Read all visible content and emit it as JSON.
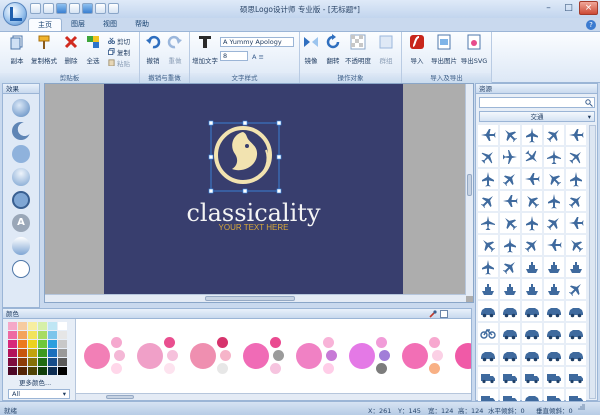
{
  "app": {
    "title": "硕思Logo设计师 专业版 - [无标题*]"
  },
  "tabs": [
    "主页",
    "图层",
    "视图",
    "帮助"
  ],
  "active_tab": "主页",
  "ribbon": {
    "groups": [
      {
        "label": "剪贴板",
        "buttons": [
          "副本",
          "复制格式",
          "删除",
          "全选"
        ],
        "small": [
          "剪切",
          "复制",
          "粘贴"
        ]
      },
      {
        "label": "撤销与重做",
        "buttons": [
          "撤销",
          "重做"
        ]
      },
      {
        "label": "文字样式",
        "buttons": [
          "增加文字"
        ],
        "font_name": "A Yummy Apology",
        "font_size": "8"
      },
      {
        "label": "操作对象",
        "buttons": [
          "镜像",
          "翻转",
          "不透明度",
          "群组"
        ]
      },
      {
        "label": "导入及导出",
        "buttons": [
          "导入",
          "导出图片",
          "导出SVG"
        ]
      }
    ]
  },
  "panels": {
    "effects": "效果",
    "resources": "资源",
    "colors": "颜色"
  },
  "resources": {
    "category": "交通",
    "icon_rows": [
      [
        "plane-icon",
        "plane-icon",
        "plane-icon",
        "plane-icon",
        "plane-icon"
      ],
      [
        "jet-icon",
        "jet-icon",
        "jet-icon",
        "jet-icon",
        "jet-icon"
      ],
      [
        "plane-icon",
        "plane-icon",
        "plane-icon",
        "plane-icon",
        "plane-icon"
      ],
      [
        "plane-icon",
        "plane-icon",
        "plane-icon",
        "plane-icon",
        "plane-icon"
      ],
      [
        "jet-icon",
        "plane-icon",
        "plane-icon",
        "plane-icon",
        "plane-icon"
      ],
      [
        "plane-icon",
        "plane-icon",
        "plane-icon",
        "plane-icon",
        "plane-icon"
      ],
      [
        "plane-icon",
        "plane-icon",
        "ship-icon",
        "ship-icon",
        "ship-icon"
      ],
      [
        "ship-icon",
        "ship-icon",
        "ship-icon",
        "ship-icon",
        "plane-icon"
      ],
      [
        "car-icon",
        "car-icon",
        "car-icon",
        "car-icon",
        "car-icon"
      ],
      [
        "bike-icon",
        "car-icon",
        "car-icon",
        "car-icon",
        "car-icon"
      ],
      [
        "car-icon",
        "car-icon",
        "car-icon",
        "car-icon",
        "car-icon"
      ],
      [
        "truck-icon",
        "truck-icon",
        "truck-icon",
        "truck-icon",
        "truck-icon"
      ],
      [
        "truck-icon",
        "truck-icon",
        "car-icon",
        "truck-icon",
        "truck-icon"
      ]
    ]
  },
  "colors": {
    "palette": [
      "#f5a8c8",
      "#f6cba0",
      "#f7eea0",
      "#d6f0a8",
      "#bfe6f4",
      "#ffffff",
      "#ee6aa2",
      "#f3a35c",
      "#f2e35c",
      "#a8dc63",
      "#7cc5eb",
      "#e6e6e6",
      "#d8287a",
      "#ec7a1f",
      "#ecd21d",
      "#6ec83a",
      "#2c9fde",
      "#c8c8c8",
      "#b3145a",
      "#c8560e",
      "#c2a30f",
      "#3e9a1f",
      "#1a6fbd",
      "#9a9a9a",
      "#7e0c3e",
      "#8d3c08",
      "#857008",
      "#1f6b12",
      "#154c8a",
      "#5a5a5a",
      "#4d0726",
      "#542405",
      "#4f4305",
      "#0f3d09",
      "#0c2c52",
      "#000000"
    ],
    "more_colors": "更多颜色...",
    "filter": "All",
    "schemes": [
      [
        "#f27fb6",
        "#f5a9cf",
        "#f4b7d6",
        "#ffd7ea"
      ],
      [
        "#f0a0c8",
        "#e94f8f",
        "#f6c1dc",
        "#fde3ef"
      ],
      [
        "#ef8fb0",
        "#d6336c",
        "#f6b4c9",
        "#e7e7e7"
      ],
      [
        "#f06bb6",
        "#ea4a90",
        "#9b9b9b",
        "#f6c4df"
      ],
      [
        "#f081c4",
        "#f8b3d8",
        "#c77ad6",
        "#ffcde8"
      ],
      [
        "#e479e6",
        "#f19cd8",
        "#a17ed8",
        "#7c7c7c"
      ],
      [
        "#f26fb5",
        "#f7a8cf",
        "#fbd0e5",
        "#f8b085"
      ],
      [
        "#f05aa7",
        "#f8a0cf",
        "#e5e5e5",
        "#c0c0c0"
      ]
    ]
  },
  "canvas": {
    "brand": "classicality",
    "slogan": "YOUR TEXT HERE",
    "bg_color": "#383e6e",
    "accent": "#f2e3b0"
  },
  "status": {
    "text": "就绪",
    "x": "X：261",
    "y": "Y：145",
    "w": "宽：124",
    "h": "高：124",
    "hskew": "水平倾斜：0",
    "vskew": "垂直倾斜：0"
  }
}
